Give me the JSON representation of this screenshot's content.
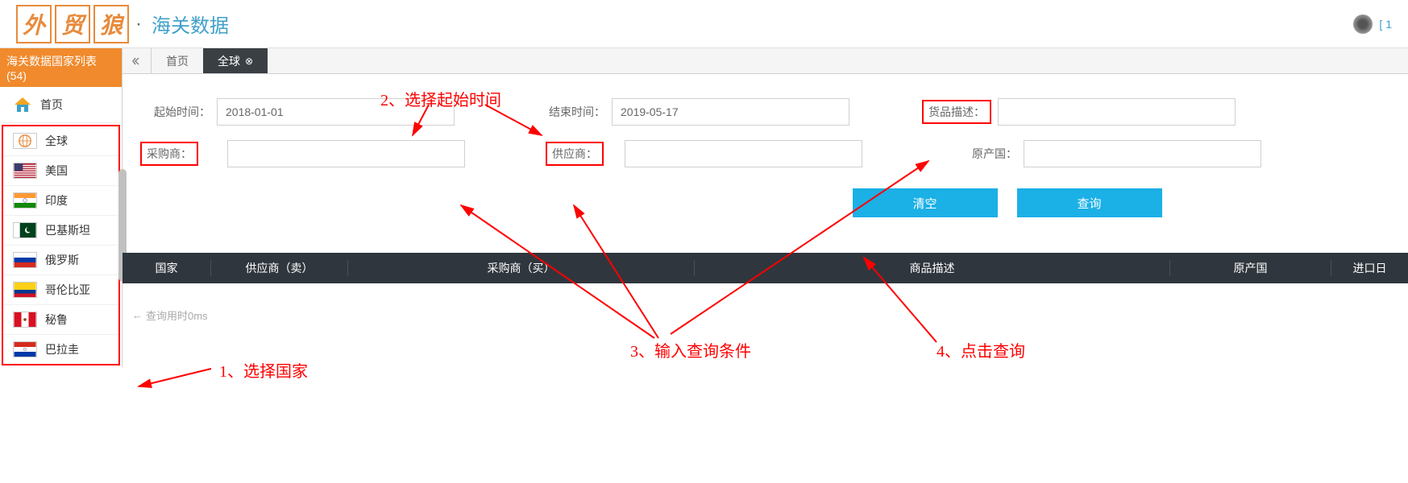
{
  "header": {
    "logo_chars": [
      "外",
      "贸",
      "狼"
    ],
    "separator": "·",
    "title": "海关数据",
    "user_prefix": "[ 1"
  },
  "sidebar": {
    "title": "海关数据国家列表(54)",
    "home_label": "首页",
    "countries": [
      {
        "label": "全球",
        "flag_type": "globe"
      },
      {
        "label": "美国",
        "flag_type": "us"
      },
      {
        "label": "印度",
        "flag_type": "in"
      },
      {
        "label": "巴基斯坦",
        "flag_type": "pk"
      },
      {
        "label": "俄罗斯",
        "flag_type": "ru"
      },
      {
        "label": "哥伦比亚",
        "flag_type": "co"
      },
      {
        "label": "秘鲁",
        "flag_type": "pe"
      },
      {
        "label": "巴拉圭",
        "flag_type": "py"
      }
    ]
  },
  "tabs": {
    "home": "首页",
    "active": "全球"
  },
  "form": {
    "start_time_label": "起始时间：",
    "start_time_value": "2018-01-01",
    "end_time_label": "结束时间：",
    "end_time_value": "2019-05-17",
    "product_desc_label": "货品描述：",
    "buyer_label": "采购商：",
    "supplier_label": "供应商：",
    "origin_label": "原产国：",
    "clear_btn": "清空",
    "query_btn": "查询"
  },
  "table": {
    "columns": {
      "country": "国家",
      "supplier": "供应商（卖）",
      "buyer": "采购商（买）",
      "desc": "商品描述",
      "origin": "原产国",
      "import_date": "进口日"
    }
  },
  "query_time": "查询用时0ms",
  "annotations": {
    "step1": "1、选择国家",
    "step2": "2、选择起始时间",
    "step3": "3、输入查询条件",
    "step4": "4、点击查询"
  }
}
